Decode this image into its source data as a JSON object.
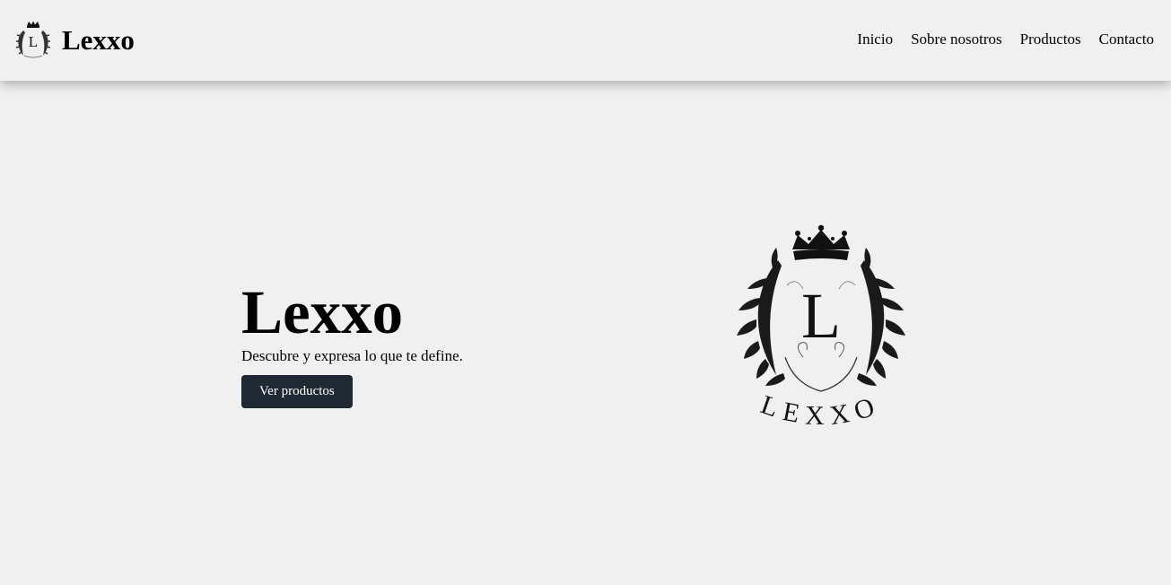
{
  "header": {
    "brand_name": "Lexxo",
    "logo_letter": "L",
    "nav": [
      {
        "label": "Inicio"
      },
      {
        "label": "Sobre nosotros"
      },
      {
        "label": "Productos"
      },
      {
        "label": "Contacto"
      }
    ]
  },
  "hero": {
    "title": "Lexxo",
    "subtitle": "Descubre y expresa lo que te define.",
    "button_label": "Ver productos",
    "logo_letter": "L",
    "logo_wordmark": "LEXXO"
  },
  "colors": {
    "background": "#f0f0f0",
    "button": "#1f2933",
    "button_text": "#ffffff"
  },
  "icons": [
    "crown-icon",
    "laurel-icon"
  ]
}
